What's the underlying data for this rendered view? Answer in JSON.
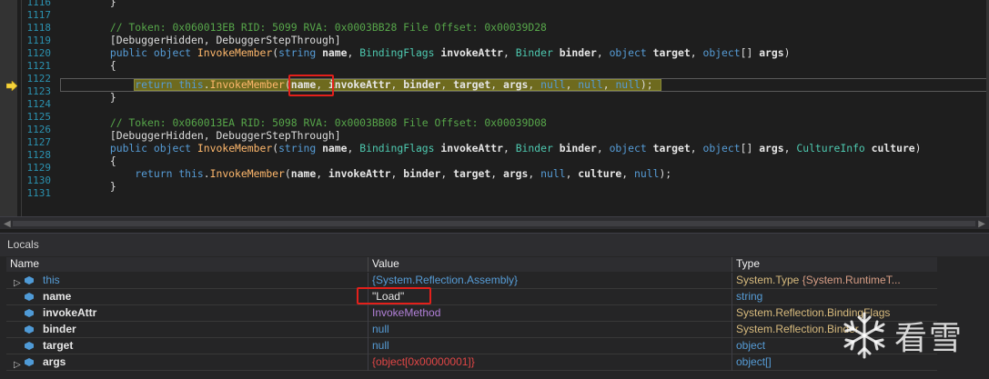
{
  "editor": {
    "lines": [
      {
        "num": "1116",
        "text": "        }"
      },
      {
        "num": "1117",
        "text": ""
      },
      {
        "num": "1118",
        "text": "        // Token: 0x060013EB RID: 5099 RVA: 0x0003BB28 File Offset: 0x00039D28"
      },
      {
        "num": "1119",
        "text": "        [DebuggerHidden, DebuggerStepThrough]"
      },
      {
        "num": "1120",
        "text": "        public object InvokeMember(string name, BindingFlags invokeAttr, Binder binder, object target, object[] args)"
      },
      {
        "num": "1121",
        "text": "        {"
      },
      {
        "num": "1122",
        "text": "            return this.InvokeMember(name, invokeAttr, binder, target, args, null, null, null);"
      },
      {
        "num": "1123",
        "text": "        }"
      },
      {
        "num": "1124",
        "text": ""
      },
      {
        "num": "1125",
        "text": "        // Token: 0x060013EA RID: 5098 RVA: 0x0003BB08 File Offset: 0x00039D08"
      },
      {
        "num": "1126",
        "text": "        [DebuggerHidden, DebuggerStepThrough]"
      },
      {
        "num": "1127",
        "text": "        public object InvokeMember(string name, BindingFlags invokeAttr, Binder binder, object target, object[] args, CultureInfo culture)"
      },
      {
        "num": "1128",
        "text": "        {"
      },
      {
        "num": "1129",
        "text": "            return this.InvokeMember(name, invokeAttr, binder, target, args, null, culture, null);"
      },
      {
        "num": "1130",
        "text": "        }"
      },
      {
        "num": "1131",
        "text": ""
      }
    ],
    "current_line": "1122"
  },
  "locals": {
    "title": "Locals",
    "columns": {
      "name": "Name",
      "value": "Value",
      "type": "Type"
    },
    "rows": [
      {
        "name": "this",
        "value": "{System.Reflection.Assembly}",
        "type_a": "System.Type",
        "type_b": " {System.RuntimeT...",
        "expandable": true
      },
      {
        "name": "name",
        "value": "\"Load\"",
        "type_a": "string",
        "type_b": "",
        "expandable": false
      },
      {
        "name": "invokeAttr",
        "value": "InvokeMethod",
        "type_a": "System.Reflection.BindingFlags",
        "type_b": "",
        "expandable": false
      },
      {
        "name": "binder",
        "value": "null",
        "type_a": "System.Reflection.Binder",
        "type_b": "",
        "expandable": false
      },
      {
        "name": "target",
        "value": "null",
        "type_a": "object",
        "type_b": "",
        "expandable": false
      },
      {
        "name": "args",
        "value": "{object[0x00000001]}",
        "type_a": "object[]",
        "type_b": "",
        "expandable": true
      }
    ]
  },
  "watermark": {
    "text": "看雪"
  },
  "colors": {
    "keyword": "#569cd6",
    "method": "#ffb86c",
    "comment": "#57a64a",
    "type": "#4ec9b0",
    "annotation_red": "#e3201b",
    "statement_highlight": "#6e6a1e"
  }
}
